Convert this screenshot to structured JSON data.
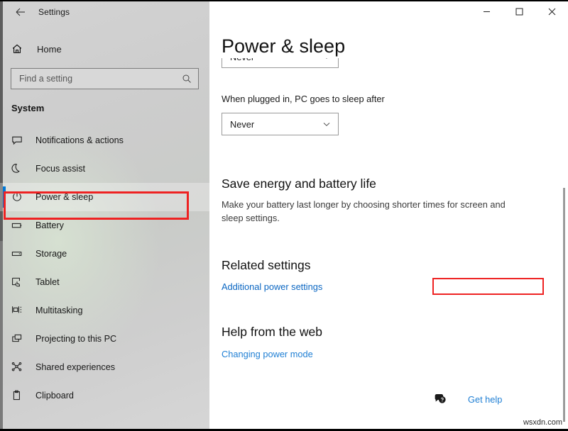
{
  "window": {
    "title": "Settings",
    "back_icon": "back-arrow-icon",
    "controls": {
      "minimize": "minimize-icon",
      "maximize": "maximize-icon",
      "close": "close-icon"
    }
  },
  "sidebar": {
    "home": {
      "label": "Home",
      "icon": "home-icon"
    },
    "search": {
      "placeholder": "Find a setting",
      "value": "",
      "icon": "search-icon"
    },
    "section_header": "System",
    "items": [
      {
        "label": "Notifications & actions",
        "icon": "notification-bubble-icon",
        "selected": false
      },
      {
        "label": "Focus assist",
        "icon": "moon-icon",
        "selected": false
      },
      {
        "label": "Power & sleep",
        "icon": "power-icon",
        "selected": true
      },
      {
        "label": "Battery",
        "icon": "battery-icon",
        "selected": false
      },
      {
        "label": "Storage",
        "icon": "storage-icon",
        "selected": false
      },
      {
        "label": "Tablet",
        "icon": "tablet-hand-icon",
        "selected": false
      },
      {
        "label": "Multitasking",
        "icon": "multitasking-icon",
        "selected": false
      },
      {
        "label": "Projecting to this PC",
        "icon": "projecting-icon",
        "selected": false
      },
      {
        "label": "Shared experiences",
        "icon": "share-nodes-icon",
        "selected": false
      },
      {
        "label": "Clipboard",
        "icon": "clipboard-icon",
        "selected": false
      }
    ]
  },
  "main": {
    "page_title": "Power & sleep",
    "sleep_on_battery": {
      "value": "Never",
      "chevron": "chevron-down-icon"
    },
    "sleep_plugged_in": {
      "label": "When plugged in, PC goes to sleep after",
      "value": "Never",
      "chevron": "chevron-down-icon"
    },
    "save_energy": {
      "heading": "Save energy and battery life",
      "body": "Make your battery last longer by choosing shorter times for screen and sleep settings."
    },
    "related_settings": {
      "heading": "Related settings",
      "link": "Additional power settings"
    },
    "help_from_web": {
      "heading": "Help from the web",
      "link": "Changing power mode"
    },
    "get_help": {
      "label": "Get help",
      "icon": "help-bubble-icon"
    }
  },
  "annotations": {
    "highlight_color": "#ee2222",
    "accent_color": "#0078d7",
    "link_color": "#0a66c2"
  },
  "watermark": "wsxdn.com"
}
